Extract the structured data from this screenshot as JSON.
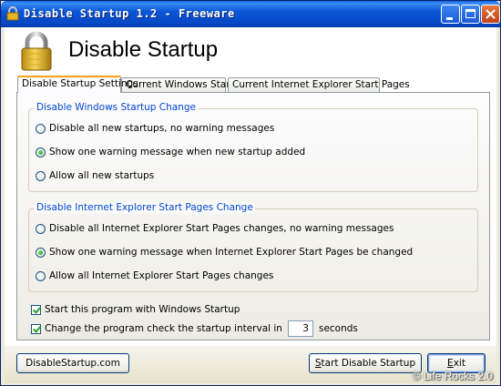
{
  "window": {
    "title": "Disable Startup 1.2 - Freeware",
    "controls": {
      "minimize": "_",
      "maximize": "□",
      "close": "×"
    }
  },
  "header": {
    "heading": "Disable Startup",
    "icon": "padlock-icon"
  },
  "tabs": [
    {
      "label": "Disable Startup Settings",
      "active": true
    },
    {
      "label": "Current Windows Startup",
      "active": false
    },
    {
      "label": "Current Internet Explorer Start Pages",
      "active": false
    }
  ],
  "windows_group": {
    "title": "Disable Windows Startup Change",
    "options": [
      {
        "label": "Disable all new startups, no warning messages",
        "selected": false
      },
      {
        "label": "Show one warning message when new startup added",
        "selected": true
      },
      {
        "label": "Allow all new startups",
        "selected": false
      }
    ]
  },
  "ie_group": {
    "title": "Disable Internet Explorer Start Pages Change",
    "options": [
      {
        "label": "Disable all Internet Explorer Start Pages changes, no warning messages",
        "selected": false
      },
      {
        "label": "Show one warning message when Internet Explorer Start Pages be changed",
        "selected": true
      },
      {
        "label": "Allow all Internet Explorer Start Pages changes",
        "selected": false
      }
    ]
  },
  "options": {
    "start_with_windows": {
      "label": "Start this program with Windows Startup",
      "checked": true
    },
    "check_interval": {
      "label": "Change the program check the startup interval in",
      "checked": true,
      "value": "3",
      "unit": "seconds"
    }
  },
  "buttons": {
    "website": "DisableStartup.com",
    "start_prefix": "S",
    "start_rest": "tart Disable Startup",
    "exit_prefix": "E",
    "exit_rest": "xit"
  },
  "watermark": "© Life Rocks 2.0"
}
